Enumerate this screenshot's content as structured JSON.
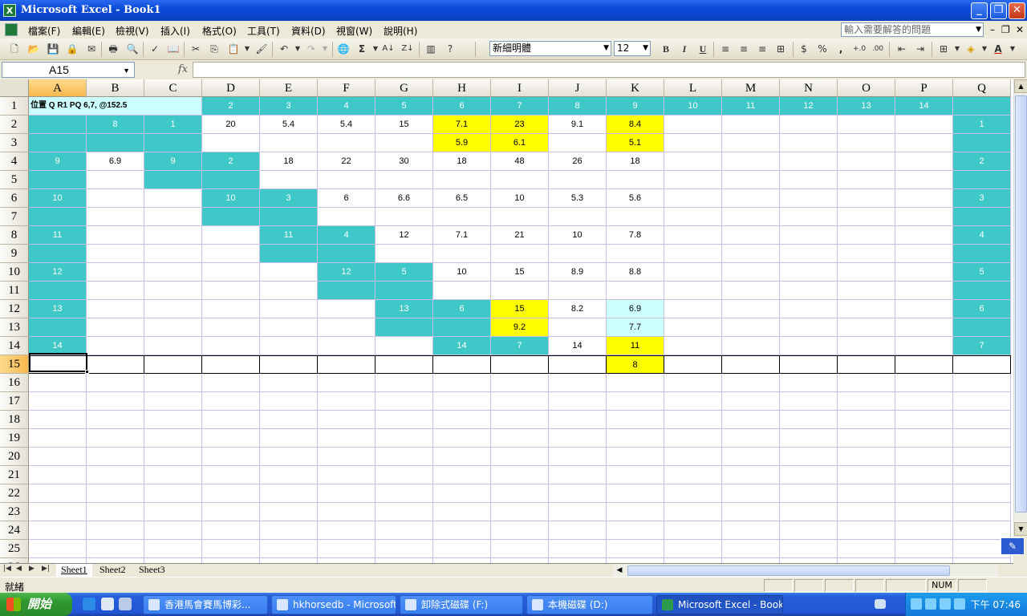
{
  "window": {
    "title": "Microsoft Excel - Book1"
  },
  "menu": [
    "檔案(F)",
    "編輯(E)",
    "檢視(V)",
    "插入(I)",
    "格式(O)",
    "工具(T)",
    "資料(D)",
    "視窗(W)",
    "說明(H)"
  ],
  "help_placeholder": "輸入需要解答的問題",
  "toolbar": {
    "font_name": "新細明體",
    "font_size": "12",
    "bold": "B",
    "italic": "I",
    "underline": "U",
    "currency": "$",
    "percent": "%",
    "comma": ","
  },
  "namebox": "A15",
  "fx": "fx",
  "columns": [
    "A",
    "B",
    "C",
    "D",
    "E",
    "F",
    "G",
    "H",
    "I",
    "J",
    "K",
    "L",
    "M",
    "N",
    "O",
    "P",
    "Q"
  ],
  "rows": [
    "1",
    "2",
    "3",
    "4",
    "5",
    "6",
    "7",
    "8",
    "9",
    "10",
    "11",
    "12",
    "13",
    "14",
    "15",
    "16",
    "17",
    "18",
    "19",
    "20",
    "21",
    "22",
    "23",
    "24",
    "25",
    "26"
  ],
  "cells": {
    "A1": "位置 Q R1 PQ 6,7, @152.5",
    "D1": "2",
    "E1": "3",
    "F1": "4",
    "G1": "5",
    "H1": "6",
    "I1": "7",
    "J1": "8",
    "K1": "9",
    "L1": "10",
    "M1": "11",
    "N1": "12",
    "O1": "13",
    "P1": "14",
    "B2": "8",
    "C2": "1",
    "D2": "20",
    "E2": "5.4",
    "F2": "5.4",
    "G2": "15",
    "H2": "7.1",
    "I2": "23",
    "J2": "9.1",
    "K2": "8.4",
    "Q2": "1",
    "H3": "5.9",
    "I3": "6.1",
    "K3": "5.1",
    "A4": "9",
    "B4": "6.9",
    "C4": "9",
    "D4": "2",
    "E4": "18",
    "F4": "22",
    "G4": "30",
    "H4": "18",
    "I4": "48",
    "J4": "26",
    "K4": "18",
    "Q4": "2",
    "A6": "10",
    "D6": "10",
    "E6": "3",
    "F6": "6",
    "G6": "6.6",
    "H6": "6.5",
    "I6": "10",
    "J6": "5.3",
    "K6": "5.6",
    "Q6": "3",
    "A8": "11",
    "E8": "11",
    "F8": "4",
    "G8": "12",
    "H8": "7.1",
    "I8": "21",
    "J8": "10",
    "K8": "7.8",
    "Q8": "4",
    "A10": "12",
    "F10": "12",
    "G10": "5",
    "H10": "10",
    "I10": "15",
    "J10": "8.9",
    "K10": "8.8",
    "Q10": "5",
    "A12": "13",
    "G12": "13",
    "H12": "6",
    "I12": "15",
    "J12": "8.2",
    "K12": "6.9",
    "Q12": "6",
    "I13": "9.2",
    "K13": "7.7",
    "A14": "14",
    "H14": "14",
    "I14": "7",
    "J14": "14",
    "K14": "11",
    "Q14": "7",
    "K15": "8"
  },
  "fills": {
    "teal": [
      "D1",
      "E1",
      "F1",
      "G1",
      "H1",
      "I1",
      "J1",
      "K1",
      "L1",
      "M1",
      "N1",
      "O1",
      "P1",
      "Q1",
      "A2",
      "B2",
      "C2",
      "Q2",
      "A3",
      "B3",
      "C3",
      "Q3",
      "A4",
      "C4",
      "D4",
      "Q4",
      "A5",
      "C5",
      "D5",
      "Q5",
      "A6",
      "D6",
      "E6",
      "Q6",
      "A7",
      "D7",
      "E7",
      "Q7",
      "A8",
      "E8",
      "F8",
      "Q8",
      "A9",
      "E9",
      "F9",
      "Q9",
      "A10",
      "F10",
      "G10",
      "Q10",
      "A11",
      "F11",
      "G11",
      "Q11",
      "A12",
      "G12",
      "H12",
      "Q12",
      "A13",
      "G13",
      "H13",
      "Q13",
      "A14",
      "H14",
      "I14",
      "Q14"
    ],
    "yellow": [
      "H2",
      "I2",
      "K2",
      "H3",
      "I3",
      "K3",
      "I12",
      "I13",
      "K14",
      "K15"
    ],
    "cyan": [
      "K12",
      "K13"
    ]
  },
  "sheets": [
    "Sheet1",
    "Sheet2",
    "Sheet3"
  ],
  "status": {
    "ready": "就緒",
    "num": "NUM"
  },
  "taskbar": {
    "start": "開始",
    "tasks": [
      "香港馬會賽馬博彩...",
      "hkhorsedb - Microsoft ...",
      "卸除式磁碟 (F:)",
      "本機磁碟 (D:)",
      "Microsoft Excel - Book1"
    ],
    "clock": "下午 07:46"
  }
}
